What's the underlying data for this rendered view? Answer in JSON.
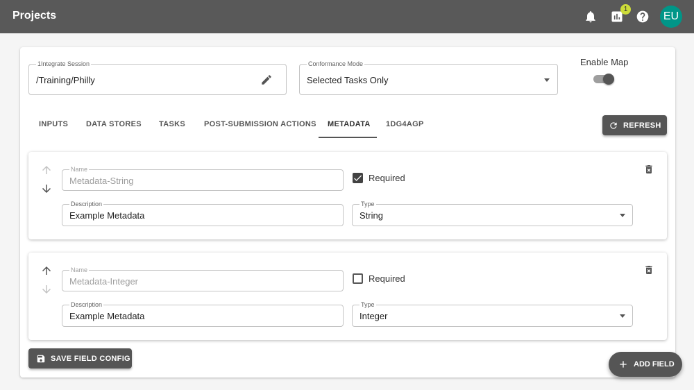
{
  "header": {
    "title": "Projects",
    "notification_badge": "1",
    "avatar_initials": "EU"
  },
  "session": {
    "label": "1Integrate Session",
    "value": "/Training/Philly"
  },
  "conformance": {
    "label": "Conformance Mode",
    "value": "Selected Tasks Only"
  },
  "enable_map": {
    "label": "Enable Map",
    "on": true
  },
  "tabs": [
    {
      "label": "INPUTS"
    },
    {
      "label": "DATA STORES"
    },
    {
      "label": "TASKS"
    },
    {
      "label": "POST-SUBMISSION ACTIONS"
    },
    {
      "label": "METADATA"
    },
    {
      "label": "1DG4AGP"
    }
  ],
  "active_tab": "METADATA",
  "refresh_label": "REFRESH",
  "fields": [
    {
      "name_label": "Name",
      "name_value": "Metadata-String",
      "required_label": "Required",
      "required": true,
      "description_label": "Description",
      "description_value": "Example Metadata",
      "type_label": "Type",
      "type_value": "String"
    },
    {
      "name_label": "Name",
      "name_value": "Metadata-Integer",
      "required_label": "Required",
      "required": false,
      "description_label": "Description",
      "description_value": "Example Metadata",
      "type_label": "Type",
      "type_value": "Integer"
    }
  ],
  "save_label": "SAVE FIELD CONFIG",
  "add_field_label": "ADD FIELD",
  "colors": {
    "appbar": "#595959",
    "avatar": "#009688",
    "badge": "#cddc39",
    "button": "#555555"
  }
}
